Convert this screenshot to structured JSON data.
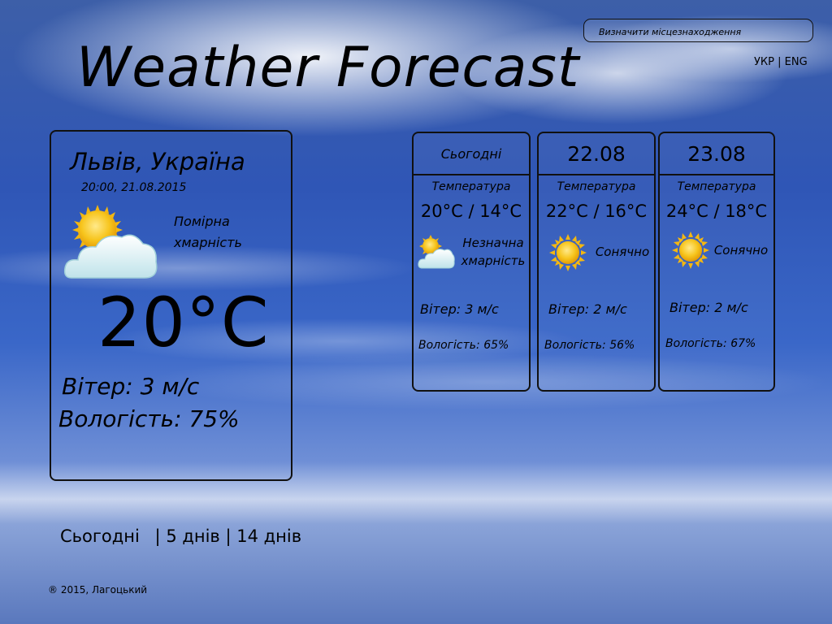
{
  "header": {
    "title": "Weather Forecast",
    "locate_button": "Визначити місцезнаходження",
    "lang_uk": "УКР",
    "lang_sep": "|",
    "lang_en": "ENG"
  },
  "current": {
    "city": "Львів, Україна",
    "datetime": "20:00, 21.08.2015",
    "condition_line1": "Помірна",
    "condition_line2": "хмарність",
    "icon": "sun-behind-cloud-icon",
    "temperature": "20°C",
    "wind": "Вітер: 3 м/с",
    "humidity": "Вологість: 75%"
  },
  "forecast": [
    {
      "header": "Сьогодні",
      "temp_label": "Температура",
      "temp": "20°C / 14°C",
      "icon": "sun-behind-cloud-icon",
      "desc_line1": "Незначна",
      "desc_line2": "хмарність",
      "wind": "Вітер: 3 м/с",
      "humidity": "Вологість: 65%"
    },
    {
      "header": "22.08",
      "temp_label": "Температура",
      "temp": "22°C / 16°C",
      "icon": "sun-icon",
      "desc_line1": "Сонячно",
      "wind": "Вітер: 2 м/с",
      "humidity": "Вологість: 56%"
    },
    {
      "header": "23.08",
      "temp_label": "Температура",
      "temp": "24°C / 18°C",
      "icon": "sun-icon",
      "desc_line1": "Сонячно",
      "wind": "Вітер: 2 м/с",
      "humidity": "Вологість: 67%"
    }
  ],
  "tabs": {
    "today": "Сьогодні",
    "sep": "|",
    "five_days": "5 днів",
    "fourteen_days": "14 днів"
  },
  "footer": {
    "copyright": "® 2015, Лагоцький"
  },
  "colors": {
    "sky_top": "#3d5fa8",
    "sky_mid": "#3a67c8",
    "border": "#111111",
    "sun": "#f6c21c"
  }
}
